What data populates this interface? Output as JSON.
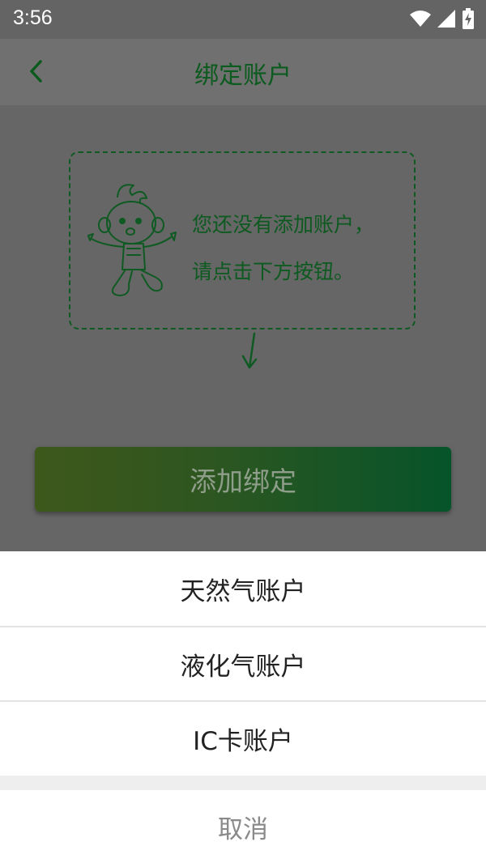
{
  "status": {
    "time": "3:56",
    "icons": [
      "wifi-icon",
      "signal-icon",
      "battery-charging-icon"
    ]
  },
  "header": {
    "title": "绑定账户",
    "back_icon": "chevron-left-icon"
  },
  "empty_state": {
    "line1": "您还没有添加账户，",
    "line2": "请点击下方按钮。",
    "mascot": "mascot-illustration",
    "arrow": "arrow-down-icon"
  },
  "add_button": {
    "label": "添加绑定"
  },
  "sheet": {
    "options": [
      {
        "label": "天然气账户"
      },
      {
        "label": "液化气账户"
      },
      {
        "label": "IC卡账户"
      }
    ],
    "cancel": "取消"
  },
  "colors": {
    "overlay": "#666666",
    "accent": "#0b5a1e",
    "button_start": "#3e581b",
    "button_end": "#06542a"
  }
}
